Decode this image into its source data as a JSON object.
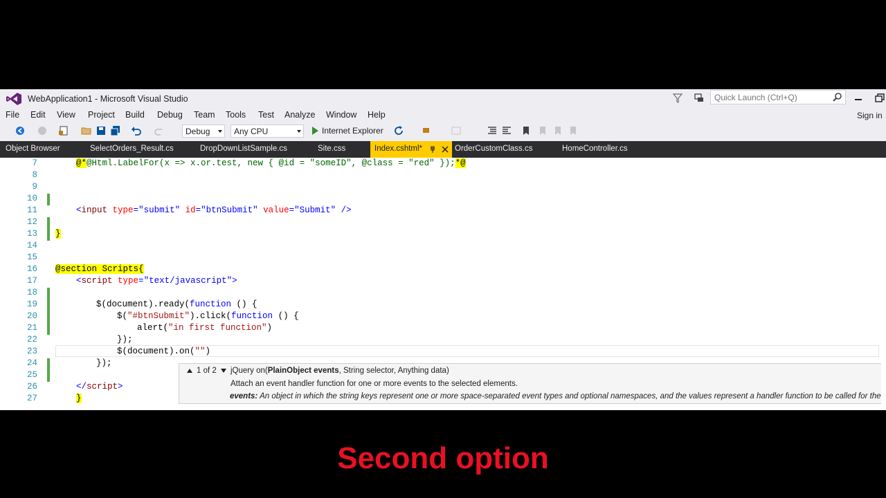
{
  "window": {
    "title": "WebApplication1 - Microsoft Visual Studio",
    "quick_launch_placeholder": "Quick Launch (Ctrl+Q)",
    "sign_in": "Sign in"
  },
  "menu": [
    "File",
    "Edit",
    "View",
    "Project",
    "Build",
    "Debug",
    "Team",
    "Tools",
    "Test",
    "Analyze",
    "Window",
    "Help"
  ],
  "toolbar": {
    "configuration": "Debug",
    "platform": "Any CPU",
    "run_target": "Internet Explorer"
  },
  "tabs": [
    "Object Browser",
    "SelectOrders_Result.cs",
    "DropDownListSample.cs",
    "Site.css",
    "Index.cshtml*",
    "OrderCustomClass.cs",
    "HomeController.cs"
  ],
  "active_tab": "Index.cshtml*",
  "editor": {
    "line_numbers": [
      "7",
      "8",
      "9",
      "10",
      "11",
      "12",
      "13",
      "14",
      "15",
      "16",
      "17",
      "18",
      "19",
      "20",
      "21",
      "22",
      "23",
      "24",
      "25",
      "26",
      "27"
    ],
    "lines": {
      "l7_a": "@*",
      "l7_b": "@Html.LabelFor(x => x.or.test, new { @id = \"someID\", @class = \"red\" });",
      "l7_c": "*@",
      "l11_open": "<",
      "l11_input": "input",
      "l11_type_attr": " type",
      "l11_eq1": "=",
      "l11_type_val": "\"submit\"",
      "l11_id_attr": " id",
      "l11_eq2": "=",
      "l11_id_val": "\"btnSubmit\"",
      "l11_val_attr": " value",
      "l11_eq3": "=",
      "l11_val_val": "\"Submit\"",
      "l11_close": " />",
      "l13": "}",
      "l16": "@section Scripts{",
      "l17_open": "<",
      "l17_script": "script",
      "l17_type": " type",
      "l17_eq": "=",
      "l17_val": "\"text/javascript\"",
      "l17_close": ">",
      "l19_a": "$(document).ready(",
      "l19_kw": "function",
      "l19_b": " () {",
      "l20_a": "$(",
      "l20_str": "\"#btnSubmit\"",
      "l20_b": ").click(",
      "l20_kw": "function",
      "l20_c": " () {",
      "l21_a": "alert(",
      "l21_str": "\"in first function\"",
      "l21_b": ")",
      "l22": "});",
      "l23_a": "$(document).on(",
      "l23_str": "\"\"",
      "l23_b": ")",
      "l24": "});",
      "l26_open": "</",
      "l26_script": "script",
      "l26_close": ">",
      "l27": "}"
    }
  },
  "signature_help": {
    "counter": "1 of 2",
    "prefix": "jQuery on(",
    "param_active": "PlainObject events",
    "rest": ", String selector, Anything data)",
    "description": "Attach an event handler function for one or more events to the selected elements.",
    "param_name": "events:",
    "param_description": "An object in which the string keys represent one or more space-separated event types and optional namespaces, and the values represent a handler function to be called for the event."
  },
  "caption": "Second option",
  "colors": {
    "accent_tab": "#ffcc00",
    "caption": "#e81123",
    "line_number": "#2b91af"
  }
}
